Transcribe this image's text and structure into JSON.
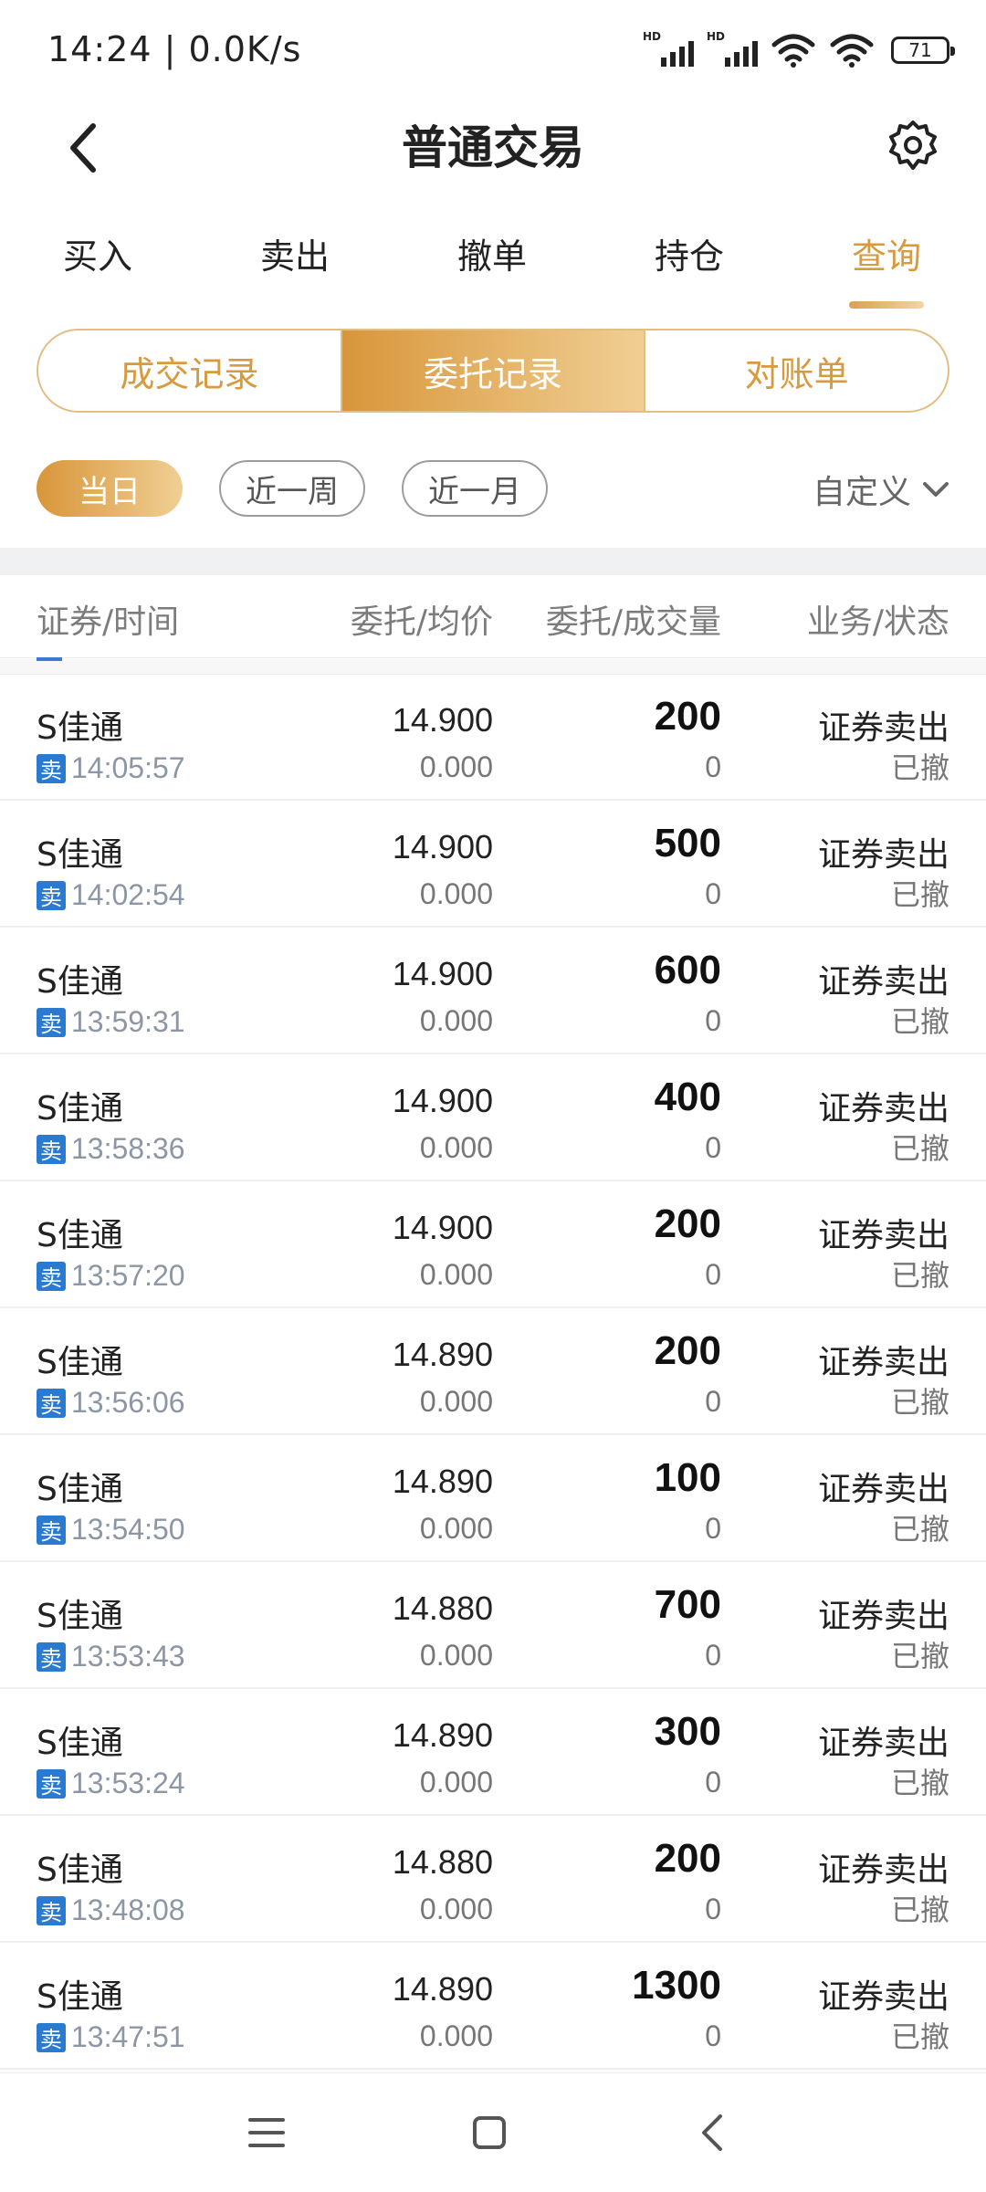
{
  "status_bar": {
    "time": "14:24 | 0.0K/s",
    "battery": "71",
    "signal_label": "HD"
  },
  "nav": {
    "title": "普通交易"
  },
  "tabs": [
    {
      "label": "买入"
    },
    {
      "label": "卖出"
    },
    {
      "label": "撤单"
    },
    {
      "label": "持仓"
    },
    {
      "label": "查询"
    }
  ],
  "active_tab": "查询",
  "segments": [
    {
      "label": "成交记录"
    },
    {
      "label": "委托记录"
    },
    {
      "label": "对账单"
    }
  ],
  "active_segment": "委托记录",
  "filters": [
    {
      "label": "当日"
    },
    {
      "label": "近一周"
    },
    {
      "label": "近一月"
    }
  ],
  "custom_filter": "自定义",
  "list_header": {
    "col1": "证券/时间",
    "col2": "委托/均价",
    "col3": "委托/成交量",
    "col4": "业务/状态"
  },
  "rows": [
    {
      "name": "S佳通",
      "side": "卖",
      "time": "14:05:57",
      "price": "14.900",
      "avg": "0.000",
      "qty": "200",
      "filled": "0",
      "biz": "证券卖出",
      "status": "已撤"
    },
    {
      "name": "S佳通",
      "side": "卖",
      "time": "14:02:54",
      "price": "14.900",
      "avg": "0.000",
      "qty": "500",
      "filled": "0",
      "biz": "证券卖出",
      "status": "已撤"
    },
    {
      "name": "S佳通",
      "side": "卖",
      "time": "13:59:31",
      "price": "14.900",
      "avg": "0.000",
      "qty": "600",
      "filled": "0",
      "biz": "证券卖出",
      "status": "已撤"
    },
    {
      "name": "S佳通",
      "side": "卖",
      "time": "13:58:36",
      "price": "14.900",
      "avg": "0.000",
      "qty": "400",
      "filled": "0",
      "biz": "证券卖出",
      "status": "已撤"
    },
    {
      "name": "S佳通",
      "side": "卖",
      "time": "13:57:20",
      "price": "14.900",
      "avg": "0.000",
      "qty": "200",
      "filled": "0",
      "biz": "证券卖出",
      "status": "已撤"
    },
    {
      "name": "S佳通",
      "side": "卖",
      "time": "13:56:06",
      "price": "14.890",
      "avg": "0.000",
      "qty": "200",
      "filled": "0",
      "biz": "证券卖出",
      "status": "已撤"
    },
    {
      "name": "S佳通",
      "side": "卖",
      "time": "13:54:50",
      "price": "14.890",
      "avg": "0.000",
      "qty": "100",
      "filled": "0",
      "biz": "证券卖出",
      "status": "已撤"
    },
    {
      "name": "S佳通",
      "side": "卖",
      "time": "13:53:43",
      "price": "14.880",
      "avg": "0.000",
      "qty": "700",
      "filled": "0",
      "biz": "证券卖出",
      "status": "已撤"
    },
    {
      "name": "S佳通",
      "side": "卖",
      "time": "13:53:24",
      "price": "14.890",
      "avg": "0.000",
      "qty": "300",
      "filled": "0",
      "biz": "证券卖出",
      "status": "已撤"
    },
    {
      "name": "S佳通",
      "side": "卖",
      "time": "13:48:08",
      "price": "14.880",
      "avg": "0.000",
      "qty": "200",
      "filled": "0",
      "biz": "证券卖出",
      "status": "已撤"
    },
    {
      "name": "S佳通",
      "side": "卖",
      "time": "13:47:51",
      "price": "14.890",
      "avg": "0.000",
      "qty": "1300",
      "filled": "0",
      "biz": "证券卖出",
      "status": "已撤"
    }
  ],
  "colors": {
    "accent": "#d89a3e",
    "badge": "#2a7ad1"
  },
  "icons": {
    "back": "chevron-left-icon",
    "settings": "gear-icon",
    "dropdown": "chevron-down-icon"
  }
}
